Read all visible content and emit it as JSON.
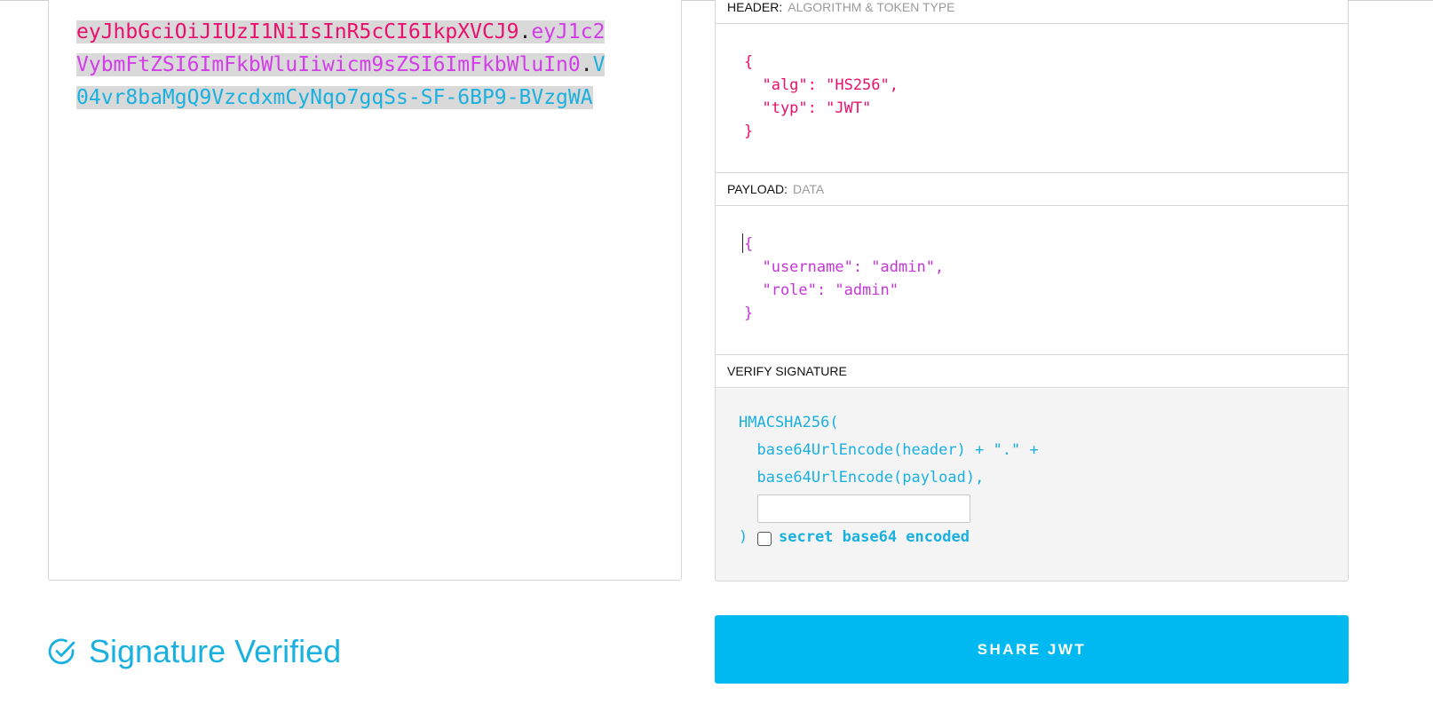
{
  "encoded": {
    "header_part": "eyJhbGciOiJIUzI1NiIsInR5cCI6IkpXVCJ9",
    "payload_part": "eyJ1c2VybmFtZSI6ImFkbWluIiwicm9sZSI6ImFkbWluIn0",
    "signature_part": "V04vr8baMgQ9VzcdxmCyNqo7gqSs-SF-6BP9-BVzgWA",
    "dot": "."
  },
  "header_section": {
    "title": "HEADER:",
    "subtitle": "ALGORITHM & TOKEN TYPE",
    "json": "{\n  \"alg\": \"HS256\",\n  \"typ\": \"JWT\"\n}"
  },
  "payload_section": {
    "title": "PAYLOAD:",
    "subtitle": "DATA",
    "json": "{\n  \"username\": \"admin\",\n  \"role\": \"admin\"\n}"
  },
  "verify_section": {
    "title": "VERIFY SIGNATURE",
    "line1": "HMACSHA256(",
    "line2": "  base64UrlEncode(header) + \".\" +",
    "line3": "  base64UrlEncode(payload),",
    "closing": ")",
    "secret_value": "",
    "checkbox_label": "secret base64 encoded"
  },
  "status": {
    "label": "Signature Verified"
  },
  "share_button": {
    "label": "SHARE JWT"
  },
  "colors": {
    "header": "#e8106c",
    "payload": "#d33ce9",
    "signature": "#1ab0e0",
    "accent": "#00b9f1"
  }
}
